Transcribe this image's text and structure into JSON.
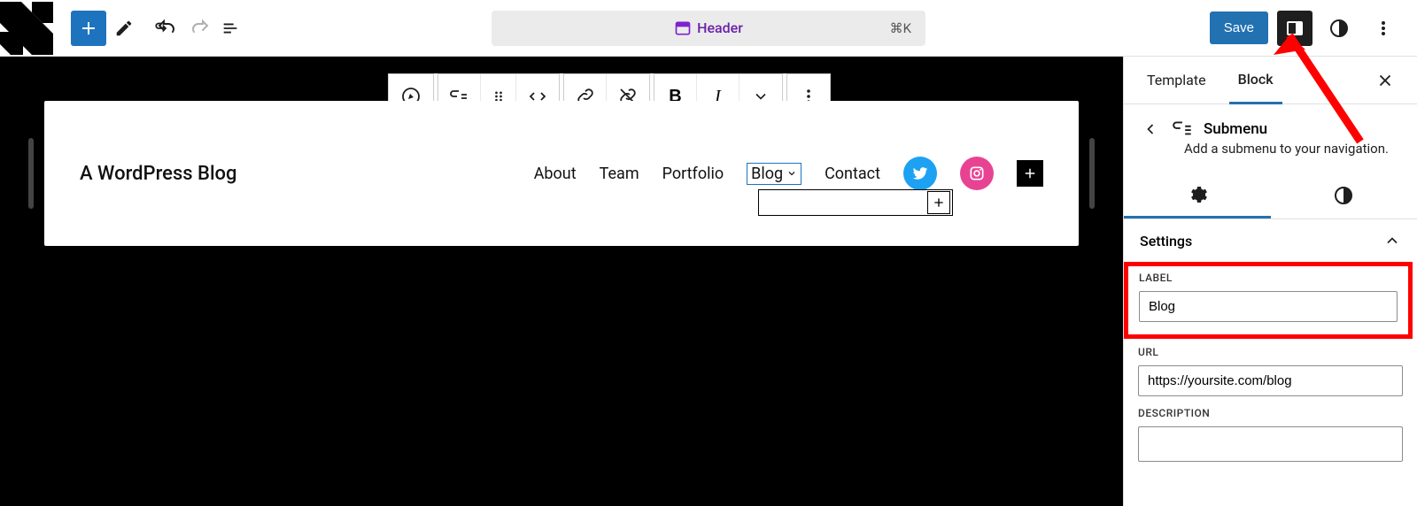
{
  "topbar": {
    "center_label": "Header",
    "shortcut": "⌘K",
    "save_label": "Save"
  },
  "canvas": {
    "site_title": "A WordPress Blog",
    "nav": {
      "items": [
        "About",
        "Team",
        "Portfolio",
        "Blog",
        "Contact"
      ],
      "selected_index": 3
    }
  },
  "sidebar": {
    "tabs": {
      "template": "Template",
      "block": "Block"
    },
    "block_name": "Submenu",
    "description": "Add a submenu to your navigation.",
    "section_title": "Settings",
    "label_field": {
      "label": "LABEL",
      "value": "Blog"
    },
    "url_field": {
      "label": "URL",
      "value": "https://yoursite.com/blog"
    },
    "description_field": {
      "label": "DESCRIPTION",
      "value": ""
    }
  }
}
